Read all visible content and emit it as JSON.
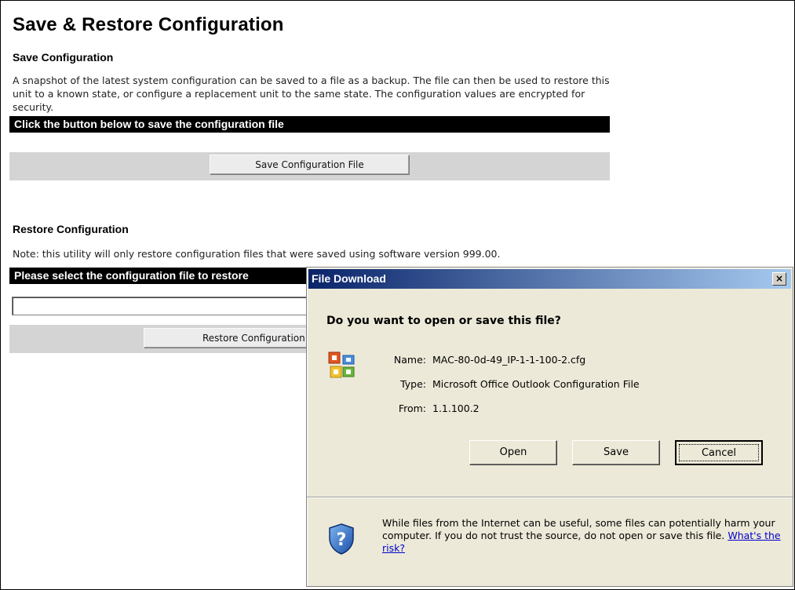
{
  "page": {
    "title": "Save & Restore Configuration"
  },
  "save_section": {
    "heading": "Save Configuration",
    "description": "A snapshot of the latest system configuration can be saved to a file as a backup. The file can then be used to restore this unit to a known state, or configure a replacement unit to the same state. The configuration values are encrypted for security.",
    "bar_text": "Click the button below to save the configuration file",
    "button_label": "Save Configuration File"
  },
  "restore_section": {
    "heading": "Restore Configuration",
    "note": "Note: this utility will only restore configuration files that were saved using software version 999.00.",
    "bar_text": "Please select the configuration file to restore",
    "file_input_value": "",
    "button_label": "Restore Configuration"
  },
  "dialog": {
    "title": "File Download",
    "close_label": "×",
    "question": "Do you want to open or save this file?",
    "name_label": "Name:",
    "name_value": "MAC-80-0d-49_IP-1-1-100-2.cfg",
    "type_label": "Type:",
    "type_value": "Microsoft Office Outlook Configuration File",
    "from_label": "From:",
    "from_value": "1.1.100.2",
    "open_label": "Open",
    "save_label": "Save",
    "cancel_label": "Cancel",
    "warning_text": "While files from the Internet can be useful, some files can potentially harm your computer. If you do not trust the source, do not open or save this file.",
    "risk_link": "What's the risk?"
  },
  "icons": {
    "file_icon": "outlook-config-file-icon",
    "shield_icon": "security-shield-question-icon"
  },
  "colors": {
    "bar_black": "#000000",
    "bar_gray": "#d4d4d4",
    "dialog_bg": "#ece9d8",
    "titlebar_start": "#0a246a",
    "link": "#0000cc"
  }
}
